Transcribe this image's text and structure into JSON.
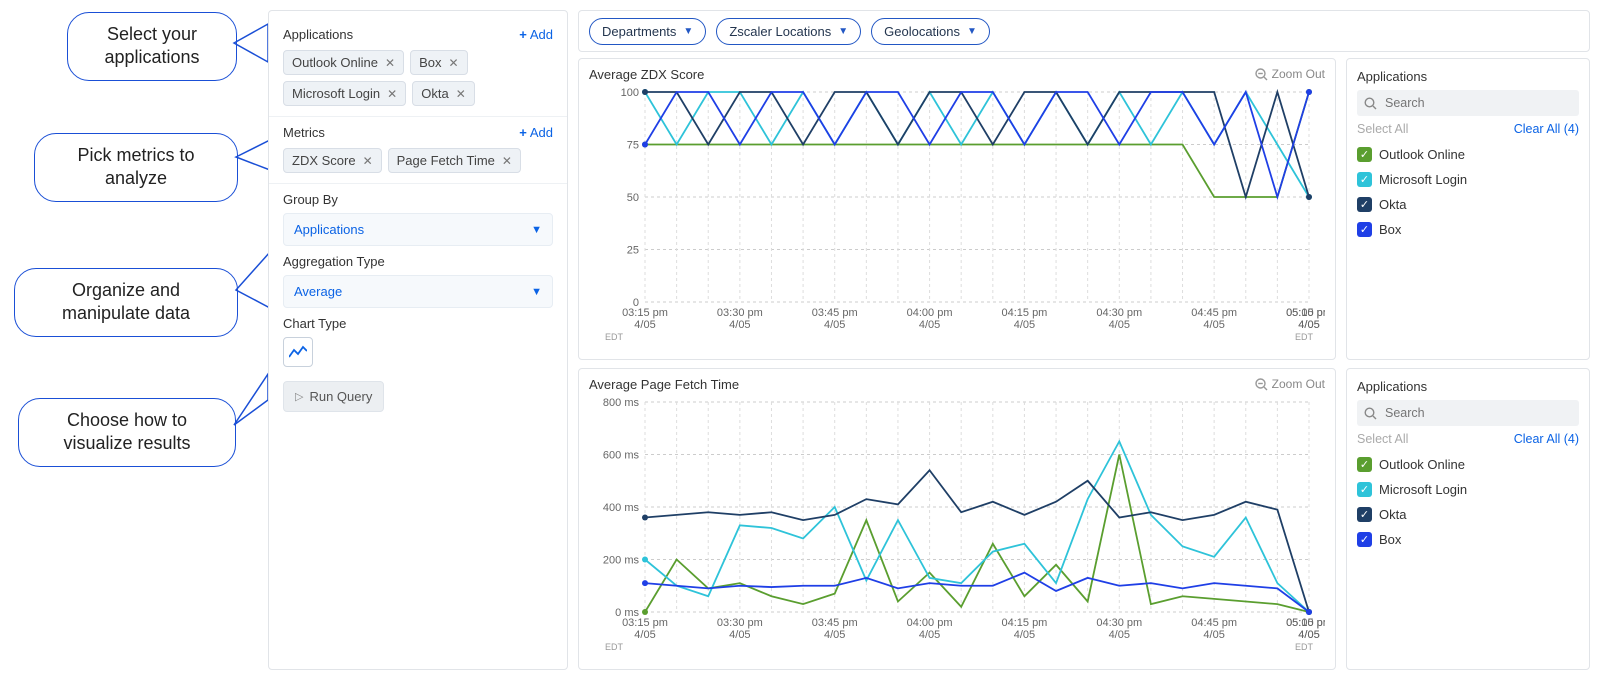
{
  "callouts": {
    "apps": "Select your\napplications",
    "metrics": "Pick metrics to\nanalyze",
    "data": "Organize and\nmanipulate data",
    "viz": "Choose how to\nvisualize results"
  },
  "sidebar": {
    "applications": {
      "title": "Applications",
      "add": "Add",
      "items": [
        "Outlook Online",
        "Box",
        "Microsoft Login",
        "Okta"
      ]
    },
    "metrics": {
      "title": "Metrics",
      "add": "Add",
      "items": [
        "ZDX Score",
        "Page Fetch Time"
      ]
    },
    "groupby": {
      "label": "Group By",
      "value": "Applications"
    },
    "aggregation": {
      "label": "Aggregation Type",
      "value": "Average"
    },
    "charttype": {
      "label": "Chart Type"
    },
    "run": "Run Query"
  },
  "filters": {
    "items": [
      "Departments",
      "Zscaler Locations",
      "Geolocations"
    ]
  },
  "timezone": "EDT",
  "chart_common": {
    "zoom": "Zoom Out",
    "x_labels": [
      "03:15 pm",
      "03:30 pm",
      "03:45 pm",
      "04:00 pm",
      "04:15 pm",
      "04:30 pm",
      "04:45 pm",
      "05:00 pm",
      "05:15 pm"
    ],
    "x_date": "4/05"
  },
  "legend_panel": {
    "title": "Applications",
    "search": "Search",
    "select_all": "Select All",
    "clear_all": "Clear All (4)",
    "items": [
      {
        "label": "Outlook Online",
        "color": "#5a9e2f"
      },
      {
        "label": "Microsoft Login",
        "color": "#2ec3d9"
      },
      {
        "label": "Okta",
        "color": "#1f3f66"
      },
      {
        "label": "Box",
        "color": "#1f3fe6"
      }
    ]
  },
  "chart_data": [
    {
      "type": "line",
      "title": "Average ZDX Score",
      "ylabel": "",
      "xlabel": "",
      "ylim": [
        0,
        100
      ],
      "yticks": [
        0,
        25,
        50,
        75,
        100
      ],
      "categories": [
        "03:15",
        "03:20",
        "03:25",
        "03:30",
        "03:35",
        "03:40",
        "03:45",
        "03:50",
        "03:55",
        "04:00",
        "04:05",
        "04:10",
        "04:15",
        "04:20",
        "04:25",
        "04:30",
        "04:35",
        "04:40",
        "04:45",
        "04:50",
        "04:55",
        "05:00"
      ],
      "series": [
        {
          "name": "Outlook Online",
          "color": "#5a9e2f",
          "values": [
            75,
            75,
            75,
            75,
            75,
            75,
            75,
            75,
            75,
            75,
            75,
            75,
            75,
            75,
            75,
            75,
            75,
            75,
            50,
            50,
            50,
            100
          ]
        },
        {
          "name": "Microsoft Login",
          "color": "#2ec3d9",
          "values": [
            100,
            75,
            100,
            100,
            75,
            100,
            75,
            100,
            75,
            100,
            75,
            100,
            75,
            100,
            75,
            100,
            75,
            100,
            75,
            100,
            75,
            50
          ]
        },
        {
          "name": "Okta",
          "color": "#1f3f66",
          "values": [
            100,
            100,
            75,
            100,
            100,
            75,
            100,
            100,
            75,
            100,
            100,
            75,
            100,
            100,
            75,
            100,
            100,
            100,
            100,
            50,
            100,
            50
          ]
        },
        {
          "name": "Box",
          "color": "#1f3fe6",
          "values": [
            75,
            100,
            100,
            75,
            100,
            100,
            75,
            100,
            100,
            75,
            100,
            100,
            75,
            100,
            100,
            75,
            100,
            100,
            75,
            100,
            50,
            100
          ]
        }
      ]
    },
    {
      "type": "line",
      "title": "Average Page Fetch Time",
      "ylabel": "",
      "xlabel": "",
      "ylim": [
        0,
        800
      ],
      "yticks": [
        0,
        200,
        400,
        600,
        800
      ],
      "yunit": " ms",
      "categories": [
        "03:15",
        "03:20",
        "03:25",
        "03:30",
        "03:35",
        "03:40",
        "03:45",
        "03:50",
        "03:55",
        "04:00",
        "04:05",
        "04:10",
        "04:15",
        "04:20",
        "04:25",
        "04:30",
        "04:35",
        "04:40",
        "04:45",
        "04:50",
        "04:55",
        "05:00"
      ],
      "series": [
        {
          "name": "Outlook Online",
          "color": "#5a9e2f",
          "values": [
            0,
            200,
            90,
            110,
            60,
            30,
            70,
            350,
            40,
            150,
            20,
            260,
            60,
            180,
            40,
            600,
            30,
            60,
            50,
            40,
            30,
            0
          ]
        },
        {
          "name": "Microsoft Login",
          "color": "#2ec3d9",
          "values": [
            200,
            100,
            60,
            330,
            320,
            280,
            400,
            120,
            350,
            130,
            110,
            230,
            260,
            110,
            430,
            650,
            370,
            250,
            210,
            360,
            110,
            0
          ]
        },
        {
          "name": "Okta",
          "color": "#1f3f66",
          "values": [
            360,
            370,
            380,
            370,
            380,
            350,
            370,
            430,
            410,
            540,
            380,
            420,
            370,
            420,
            500,
            360,
            380,
            350,
            370,
            420,
            390,
            0
          ]
        },
        {
          "name": "Box",
          "color": "#1f3fe6",
          "values": [
            110,
            100,
            90,
            100,
            95,
            100,
            100,
            130,
            90,
            110,
            100,
            100,
            150,
            80,
            130,
            100,
            110,
            90,
            110,
            100,
            90,
            0
          ]
        }
      ]
    }
  ]
}
